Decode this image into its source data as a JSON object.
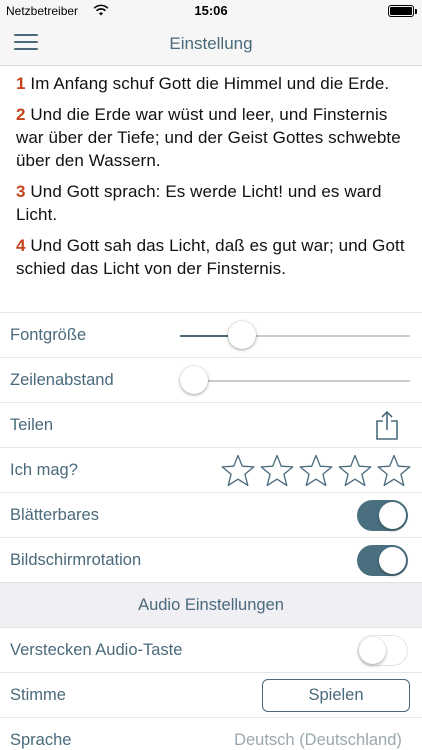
{
  "status_bar": {
    "carrier": "Netzbetreiber",
    "time": "15:06",
    "battery_level": 1.0
  },
  "nav": {
    "title": "Einstellung",
    "menu_icon": "hamburger-menu-icon"
  },
  "preview": {
    "verses": [
      {
        "num": "1",
        "text": " Im Anfang schuf Gott die Himmel und die Erde."
      },
      {
        "num": "2",
        "text": " Und die Erde war wüst und leer, und Finsternis war über der Tiefe; und der Geist Gottes schwebte über den Wassern."
      },
      {
        "num": "3",
        "text": " Und Gott sprach: Es werde Licht! und es ward Licht."
      },
      {
        "num": "4",
        "text": " Und Gott sah das Licht, daß es gut war; und Gott schied das Licht von der Finsternis."
      }
    ]
  },
  "settings": {
    "font_size": {
      "label": "Fontgröße",
      "value": 0.24
    },
    "line_spacing": {
      "label": "Zeilenabstand",
      "value": 0.0
    },
    "share": {
      "label": "Teilen",
      "icon": "share-icon"
    },
    "like": {
      "label": "Ich mag?",
      "rating": 0,
      "max": 5,
      "icon": "star-outline-icon"
    },
    "paging": {
      "label": "Blätterbares",
      "on": true
    },
    "rotation": {
      "label": "Bildschirmrotation",
      "on": true
    }
  },
  "audio": {
    "section_title": "Audio Einstellungen",
    "hide_audio_button": {
      "label": "Verstecken Audio-Taste",
      "on": false
    },
    "voice": {
      "label": "Stimme",
      "button_label": "Spielen"
    },
    "language": {
      "label": "Sprache",
      "value": "Deutsch (Deutschland)"
    }
  },
  "colors": {
    "accent": "#4a6a7c",
    "verse_number": "#c4431a",
    "toggle_on": "#4a6f7f",
    "section_bg": "#efeff4"
  }
}
